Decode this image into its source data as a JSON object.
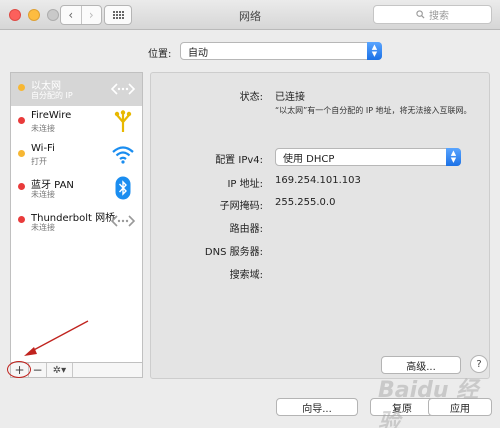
{
  "window": {
    "title": "网络",
    "search_placeholder": "搜索"
  },
  "location": {
    "label": "位置:",
    "value": "自动"
  },
  "services": [
    {
      "name": "以太网",
      "status": "自分配的 IP",
      "dot": "yellow",
      "icon": "ethernet-icon",
      "selected": true
    },
    {
      "name": "FireWire",
      "status": "未连接",
      "dot": "red",
      "icon": "firewire-icon",
      "selected": false
    },
    {
      "name": "Wi-Fi",
      "status": "打开",
      "dot": "yellow",
      "icon": "wifi-icon",
      "selected": false
    },
    {
      "name": "蓝牙 PAN",
      "status": "未连接",
      "dot": "red",
      "icon": "bluetooth-icon",
      "selected": false
    },
    {
      "name": "Thunderbolt 网桥",
      "status": "未连接",
      "dot": "red",
      "icon": "thunderbolt-bridge-icon",
      "selected": false
    }
  ],
  "detail": {
    "status_label": "状态:",
    "status_value": "已连接",
    "status_note": "“以太网”有一个自分配的 IP 地址，将无法接入互联网。",
    "configure_label": "配置 IPv4:",
    "configure_value": "使用 DHCP",
    "ip_label": "IP 地址:",
    "ip_value": "169.254.101.103",
    "mask_label": "子网掩码:",
    "mask_value": "255.255.0.0",
    "router_label": "路由器:",
    "dns_label": "DNS 服务器:",
    "search_domain_label": "搜索域:",
    "advanced_button": "高级...",
    "help_button": "?"
  },
  "toolbar": {
    "add": "+",
    "remove": "−",
    "gear": "✲▾"
  },
  "footer": {
    "assist": "向导...",
    "revert": "复原",
    "apply": "应用"
  },
  "watermark": "Baidu 经验",
  "colors": {
    "accent": "#1b71e6",
    "annotation": "#c0231e",
    "selected": "#d6d6d6"
  }
}
